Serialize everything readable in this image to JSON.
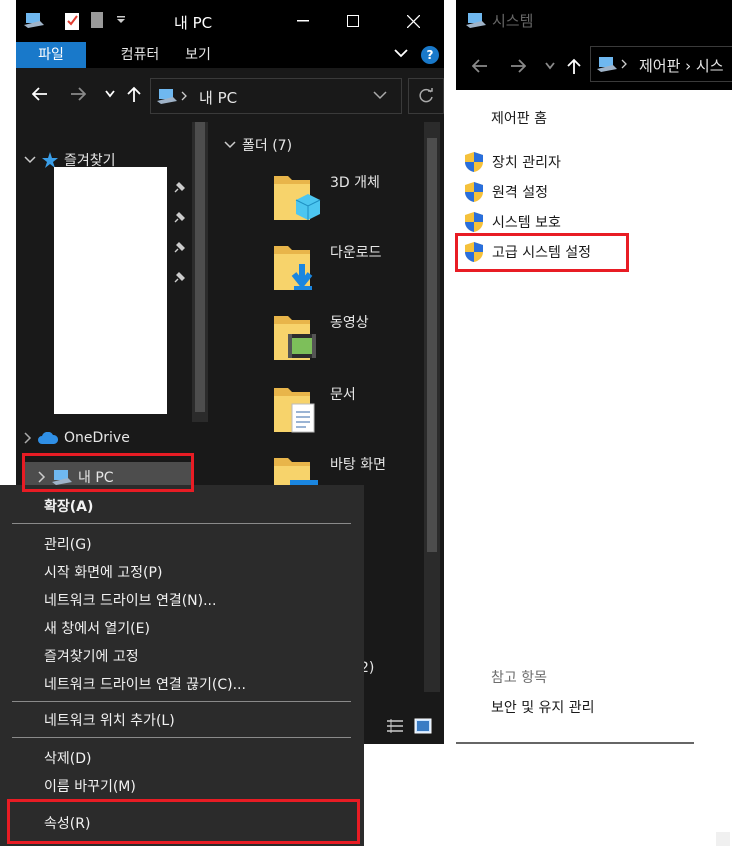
{
  "explorer": {
    "title": "내 PC",
    "qa_icons": [
      "pc-icon",
      "checklist-icon",
      "folder-icon",
      "dropdown-arrow-icon"
    ],
    "ribbon_tabs": [
      "파일",
      "컴퓨터",
      "보기"
    ],
    "address": "내 PC",
    "nav": {
      "favorites": "즐겨찾기",
      "onedrive": "OneDrive",
      "mypc": "내 PC"
    },
    "group_header": "폴더 (7)",
    "folders": [
      "3D 개체",
      "다운로드",
      "동영상",
      "문서",
      "바탕 화면"
    ],
    "partial_count": "2)"
  },
  "context_menu": {
    "items": [
      {
        "label": "확장(A)",
        "bold": true
      },
      {
        "label": "관리(G)"
      },
      {
        "label": "시작 화면에 고정(P)"
      },
      {
        "label": "네트워크 드라이브 연결(N)..."
      },
      {
        "label": "새 창에서 열기(E)"
      },
      {
        "label": "즐겨찾기에 고정"
      },
      {
        "label": "네트워크 드라이브 연결 끊기(C)..."
      },
      {
        "label": "네트워크 위치 추가(L)"
      },
      {
        "label": "삭제(D)"
      },
      {
        "label": "이름 바꾸기(M)"
      },
      {
        "label": "속성(R)"
      }
    ]
  },
  "system": {
    "title": "시스템",
    "address": "제어판  ›  시스",
    "home": "제어판 홈",
    "links": [
      "장치 관리자",
      "원격 설정",
      "시스템 보호",
      "고급 시스템 설정"
    ],
    "see_also": "참고 항목",
    "security_maintenance": "보안 및 유지 관리"
  },
  "colors": {
    "highlight": "#e81c24",
    "accent": "#1979ca",
    "dark_bg": "#191919",
    "menu_bg": "#2b2b2b"
  }
}
